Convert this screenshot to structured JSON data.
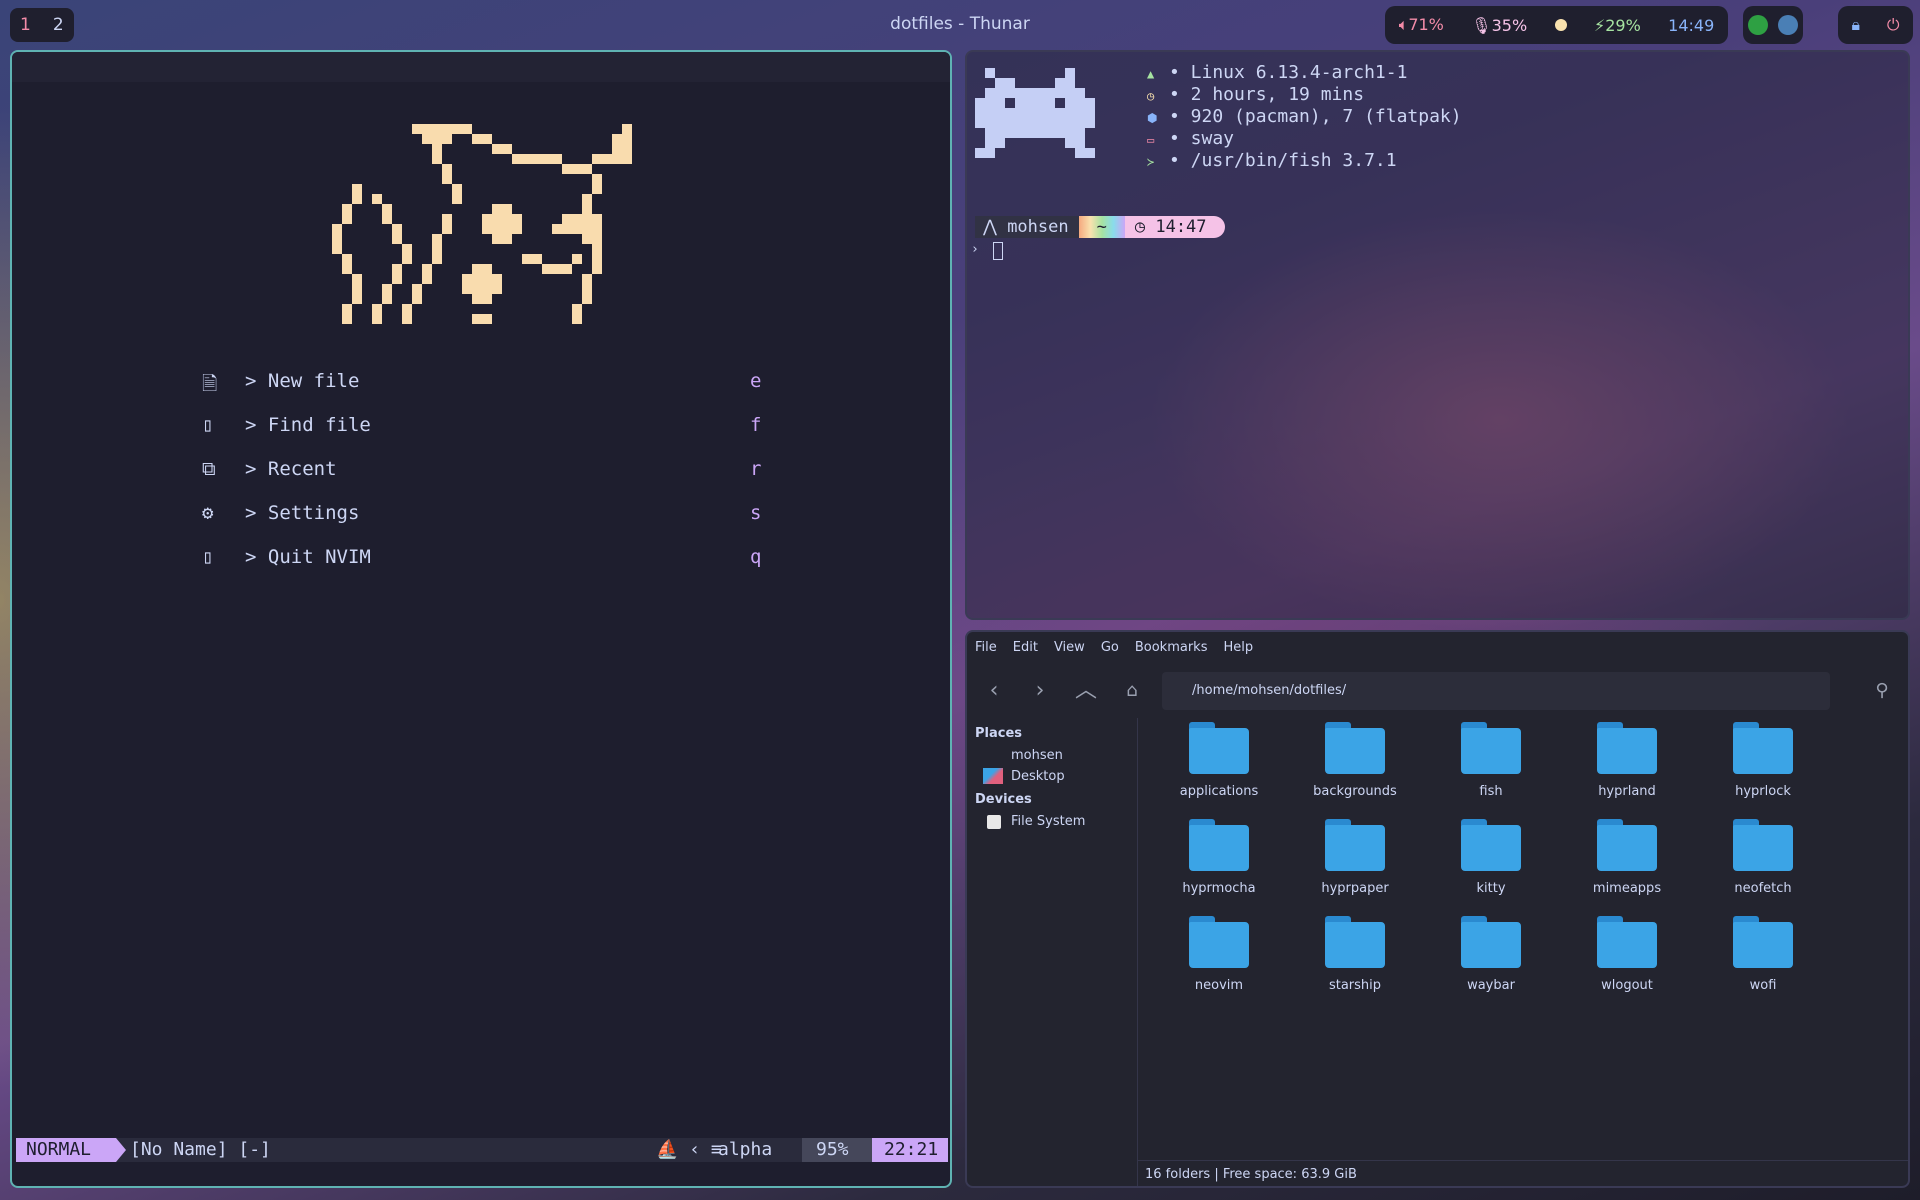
{
  "topbar": {
    "workspaces": [
      "1",
      "2"
    ],
    "window_title": "dotfiles - Thunar",
    "status": {
      "volume": "71%",
      "mic": "35%",
      "battery": "29%",
      "clock": "14:49"
    }
  },
  "nvim": {
    "menu": [
      {
        "label": "> New file",
        "key": "e",
        "icon": "file-icon"
      },
      {
        "label": "> Find file",
        "key": "f",
        "icon": "search-icon"
      },
      {
        "label": "> Recent",
        "key": "r",
        "icon": "recent-icon"
      },
      {
        "label": "> Settings",
        "key": "s",
        "icon": "gear-icon"
      },
      {
        "label": "> Quit NVIM",
        "key": "q",
        "icon": "quit-icon"
      }
    ],
    "statusline": {
      "mode": "NORMAL",
      "buffer": "[No Name] [-]",
      "filetype": "alpha",
      "percent": "95%",
      "position": "22:21"
    }
  },
  "terminal": {
    "fetch": [
      {
        "icon": "arch-icon",
        "text": "• Linux 6.13.4-arch1-1"
      },
      {
        "icon": "clock-icon",
        "text": "• 2 hours, 19 mins"
      },
      {
        "icon": "package-icon",
        "text": "• 920 (pacman), 7 (flatpak)"
      },
      {
        "icon": "window-icon",
        "text": "• sway"
      },
      {
        "icon": "shell-icon",
        "text": "• /usr/bin/fish 3.7.1"
      }
    ],
    "prompt": {
      "user": "mohsen",
      "dir": "~",
      "time": "14:47"
    }
  },
  "thunar": {
    "menu": [
      "File",
      "Edit",
      "View",
      "Go",
      "Bookmarks",
      "Help"
    ],
    "path": "/home/mohsen/dotfiles/",
    "places_heading": "Places",
    "places": [
      "mohsen",
      "Desktop"
    ],
    "devices_heading": "Devices",
    "devices": [
      "File System"
    ],
    "folders": [
      "applications",
      "backgrounds",
      "fish",
      "hyprland",
      "hyprlock",
      "hyprmocha",
      "hyprpaper",
      "kitty",
      "mimeapps",
      "neofetch",
      "neovim",
      "starship",
      "waybar",
      "wlogout",
      "wofi"
    ],
    "statusbar": "16 folders  |  Free space: 63.9 GiB"
  },
  "colors": {
    "accent": "#cba6f7",
    "nvim_border": "#5fb3b3",
    "folder": "#3ba4e6",
    "logo": "#f9dcae"
  }
}
